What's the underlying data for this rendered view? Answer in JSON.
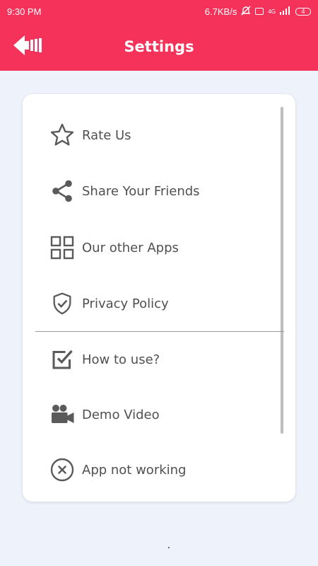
{
  "status_bar": {
    "time": "9:30 PM",
    "network_speed": "6.7KB/s",
    "network_type": "4G",
    "battery": "4"
  },
  "app_bar": {
    "title": "Settings",
    "back_icon": "arrow-left-icon"
  },
  "colors": {
    "accent": "#f5325a",
    "background": "#eef2fa",
    "card": "#ffffff",
    "icon": "#5a5a5a"
  },
  "settings": {
    "items": [
      {
        "label": "Rate Us",
        "icon": "star-icon"
      },
      {
        "label": "Share Your Friends",
        "icon": "share-icon"
      },
      {
        "label": "Our other Apps",
        "icon": "grid-icon"
      },
      {
        "label": "Privacy Policy",
        "icon": "shield-check-icon"
      },
      {
        "label": "How to use?",
        "icon": "checkbox-icon"
      },
      {
        "label": "Demo Video",
        "icon": "video-camera-icon"
      },
      {
        "label": "App not working",
        "icon": "cancel-circle-icon"
      }
    ]
  }
}
